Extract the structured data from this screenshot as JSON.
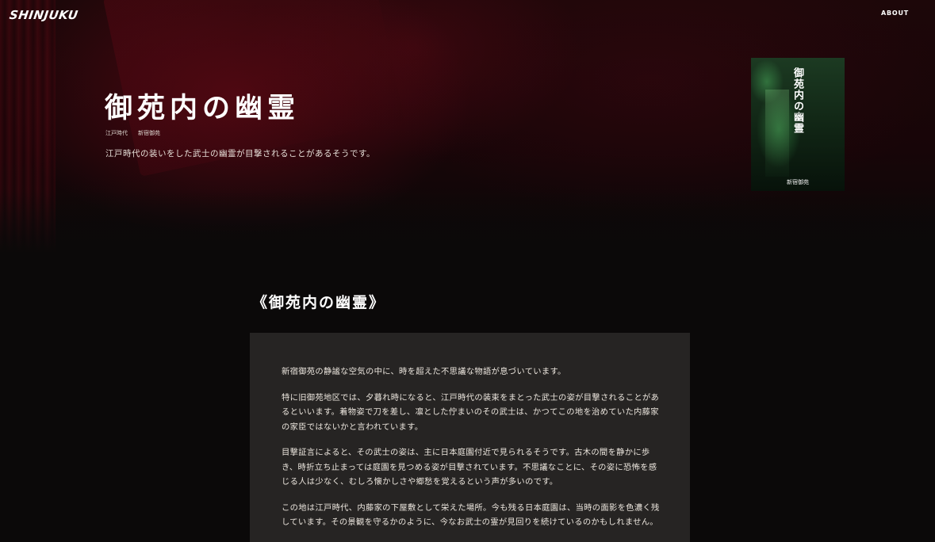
{
  "header": {
    "logo": "SHINJUKU",
    "nav": [
      {
        "label": "ABOUT"
      }
    ]
  },
  "hero": {
    "title": "御苑内の幽霊",
    "tags": [
      "江戸時代",
      "新宿御苑"
    ],
    "description": "江戸時代の装いをした武士の幽霊が目撃されることがあるそうです。"
  },
  "cover": {
    "title": "御苑内の幽霊",
    "subtitle": "新宿御苑"
  },
  "article": {
    "heading": "《御苑内の幽霊》",
    "paragraphs": [
      "新宿御苑の静謐な空気の中に、時を超えた不思議な物語が息づいています。",
      "特に旧御苑地区では、夕暮れ時になると、江戸時代の装束をまとった武士の姿が目撃されることがあるといいます。着物姿で刀を差し、凛とした佇まいのその武士は、かつてこの地を治めていた内藤家の家臣ではないかと言われています。",
      "目撃証言によると、その武士の姿は、主に日本庭園付近で見られるそうです。古木の間を静かに歩き、時折立ち止まっては庭園を見つめる姿が目撃されています。不思議なことに、その姿に恐怖を感じる人は少なく、むしろ懐かしさや郷愁を覚えるという声が多いのです。",
      "この地は江戸時代、内藤家の下屋敷として栄えた場所。今も残る日本庭園は、当時の面影を色濃く残しています。その景観を守るかのように、今なお武士の霊が見回りを続けているのかもしれません。"
    ]
  }
}
